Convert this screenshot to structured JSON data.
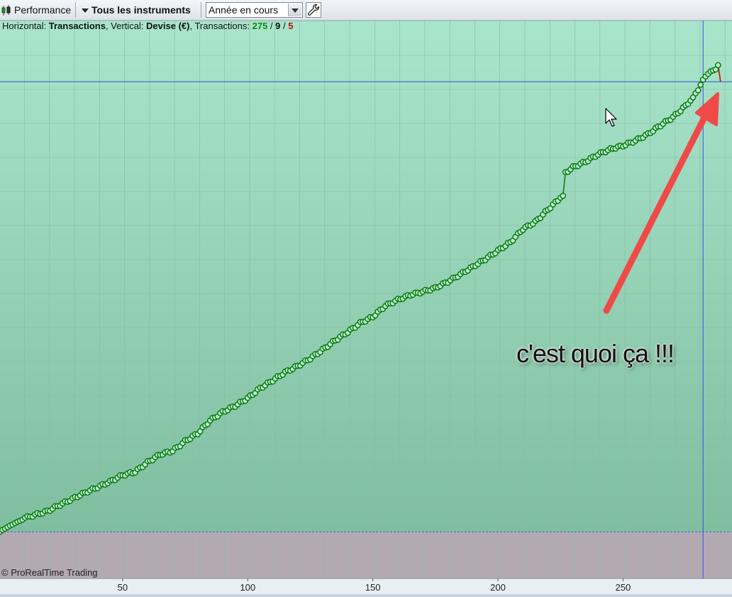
{
  "toolbar": {
    "performance_label": "Performance",
    "instruments_label": "Tous les instruments",
    "period_value": "Année en cours"
  },
  "info": {
    "h_prefix": "Horizontal: ",
    "h_value": "Transactions",
    "v_prefix": ", Vertical: ",
    "v_value": "Devise (€)",
    "t_prefix": ", Transactions: ",
    "count_total": "275",
    "sep": " / ",
    "count_black": "9",
    "count_red": "5"
  },
  "copyright": "© ProRealTime Trading",
  "annotation": "c'est quoi ça !!!",
  "colors": {
    "line": "#0e7a12",
    "marker_fill": "#b9efd0",
    "crosshair": "#3355dd",
    "drop": "#d01818",
    "arrow": "#ef4a48",
    "bg_top": "#a9e5cb",
    "bg_bottom": "#7fbd9f",
    "negative_zone": "#b3a9b1"
  },
  "chart_data": {
    "type": "line",
    "xlabel": "Transactions",
    "ylabel": "Devise (€)",
    "xlim": [
      1,
      289
    ],
    "ylim": [
      -8.2,
      100
    ],
    "x_ticks": [
      "50",
      "100",
      "150",
      "200",
      "250"
    ],
    "grid": true,
    "points": [
      [
        1,
        0
      ],
      [
        2,
        0.6
      ],
      [
        3,
        1.0
      ],
      [
        4,
        1.5
      ],
      [
        5,
        2.0
      ],
      [
        6,
        2.3
      ],
      [
        7,
        2.8
      ],
      [
        8,
        3.2
      ],
      [
        9,
        3.5
      ],
      [
        10,
        3.9
      ],
      [
        11,
        4.5
      ],
      [
        12,
        4.6
      ],
      [
        15,
        5.4
      ],
      [
        20,
        6.6
      ],
      [
        25,
        8.6
      ],
      [
        30,
        10.5
      ],
      [
        35,
        12.5
      ],
      [
        40,
        14.2
      ],
      [
        45,
        16.0
      ],
      [
        50,
        18.1
      ],
      [
        55,
        19.1
      ],
      [
        60,
        22.2
      ],
      [
        65,
        24.7
      ],
      [
        70,
        25.8
      ],
      [
        75,
        28.9
      ],
      [
        80,
        31.4
      ],
      [
        85,
        35.5
      ],
      [
        90,
        38.2
      ],
      [
        95,
        40.2
      ],
      [
        100,
        42.6
      ],
      [
        105,
        45.8
      ],
      [
        110,
        48.3
      ],
      [
        115,
        50.9
      ],
      [
        120,
        52.9
      ],
      [
        125,
        55.3
      ],
      [
        130,
        58.1
      ],
      [
        135,
        61.1
      ],
      [
        140,
        63.7
      ],
      [
        145,
        66.6
      ],
      [
        150,
        68.6
      ],
      [
        155,
        72.1
      ],
      [
        160,
        74.0
      ],
      [
        165,
        75.6
      ],
      [
        170,
        76.6
      ],
      [
        175,
        77.8
      ],
      [
        180,
        79.8
      ],
      [
        185,
        82.1
      ],
      [
        190,
        84.6
      ],
      [
        195,
        87.0
      ],
      [
        200,
        89.7
      ],
      [
        205,
        92.4
      ],
      [
        210,
        96.6
      ],
      [
        215,
        98.9
      ],
      [
        220,
        102.8
      ],
      [
        225,
        106.6
      ],
      [
        226,
        107.2
      ],
      [
        227,
        114.6
      ],
      [
        230,
        116.3
      ],
      [
        235,
        118.1
      ],
      [
        240,
        120.4
      ],
      [
        245,
        122.1
      ],
      [
        250,
        123.2
      ],
      [
        255,
        124.8
      ],
      [
        260,
        126.9
      ],
      [
        265,
        129.7
      ],
      [
        270,
        132.3
      ],
      [
        275,
        135.9
      ],
      [
        278,
        138.6
      ],
      [
        280,
        141.2
      ],
      [
        283,
        145.3
      ],
      [
        285,
        146.9
      ],
      [
        287,
        147.5
      ],
      [
        288,
        148.9
      ]
    ],
    "final_drop": [
      [
        288,
        148.9
      ],
      [
        289,
        143.6
      ]
    ],
    "crosshair": {
      "x": 282,
      "y": 143.6
    }
  }
}
